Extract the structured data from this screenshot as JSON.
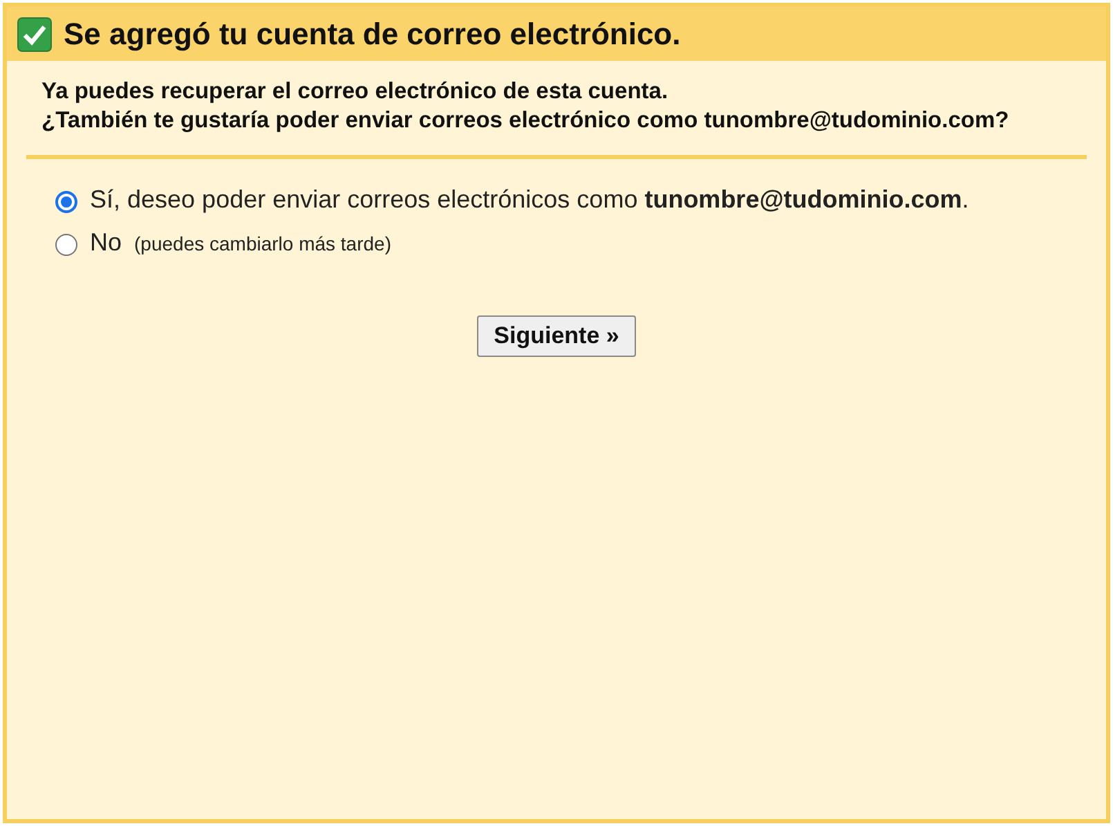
{
  "header": {
    "checked": true,
    "title": "Se agregó tu cuenta de correo electrónico."
  },
  "message": [
    "Ya puedes recuperar el correo electrónico de esta cuenta.",
    "¿También te gustaría poder enviar correos electrónico como tunombre@tudominio.com?"
  ],
  "options": [
    {
      "label": "Sí, deseo poder enviar correos electrónicos como **tunombre@tudominio.com**.",
      "selected": true
    },
    {
      "label": "No",
      "note": "(puedes cambiarlo más tarde)",
      "selected": false
    }
  ],
  "button": "Siguiente »"
}
